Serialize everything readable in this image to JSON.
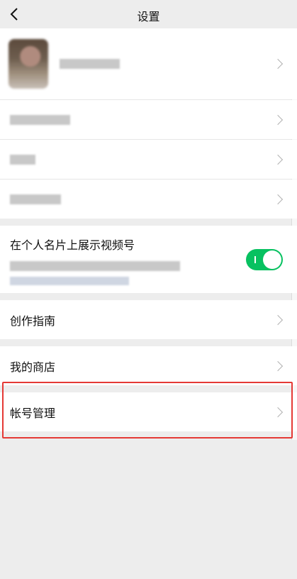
{
  "nav": {
    "title": "设置",
    "back_icon": "chevron-left-icon"
  },
  "profile_group": {
    "items": [
      {
        "type": "profile",
        "avatar": "avatar",
        "name": ""
      },
      {
        "type": "blurred",
        "label": ""
      },
      {
        "type": "blurred",
        "label": ""
      },
      {
        "type": "blurred",
        "label": ""
      }
    ]
  },
  "channel_toggle": {
    "label": "在个人名片上展示视频号",
    "description": "",
    "enabled": true
  },
  "menu": {
    "guide_label": "创作指南",
    "shop_label": "我的商店",
    "account_label": "帐号管理"
  },
  "colors": {
    "toggle_on": "#07c160",
    "highlight": "#e53935",
    "background": "#ededed"
  }
}
